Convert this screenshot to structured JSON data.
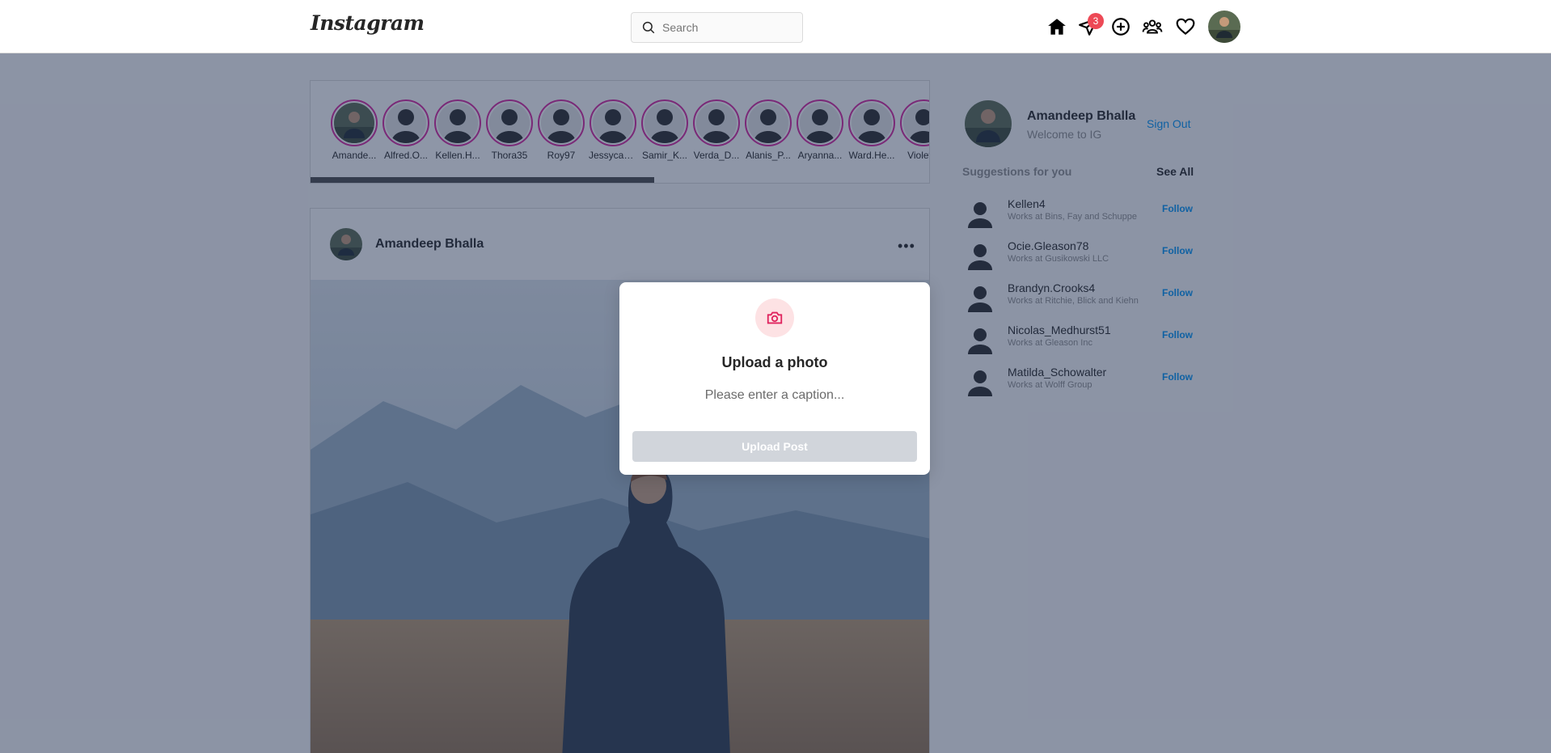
{
  "header": {
    "logo": "Instagram",
    "search_placeholder": "Search",
    "notification_count": "3"
  },
  "stories": [
    {
      "name": "Amande..."
    },
    {
      "name": "Alfred.O..."
    },
    {
      "name": "Kellen.H..."
    },
    {
      "name": "Thora35"
    },
    {
      "name": "Roy97"
    },
    {
      "name": "Jessyca_..."
    },
    {
      "name": "Samir_K..."
    },
    {
      "name": "Verda_D..."
    },
    {
      "name": "Alanis_P..."
    },
    {
      "name": "Aryanna..."
    },
    {
      "name": "Ward.He..."
    },
    {
      "name": "Violette"
    }
  ],
  "post": {
    "username": "Amandeep Bhalla",
    "more_label": "•••"
  },
  "sidebar": {
    "profile_name": "Amandeep Bhalla",
    "welcome": "Welcome to IG",
    "sign_out": "Sign Out",
    "suggestions_title": "Suggestions for you",
    "see_all": "See All",
    "follow_label": "Follow",
    "suggestions": [
      {
        "name": "Kellen4",
        "desc": "Works at Bins, Fay and Schuppe"
      },
      {
        "name": "Ocie.Gleason78",
        "desc": "Works at Gusikowski LLC"
      },
      {
        "name": "Brandyn.Crooks4",
        "desc": "Works at Ritchie, Blick and Kiehn"
      },
      {
        "name": "Nicolas_Medhurst51",
        "desc": "Works at Gleason Inc"
      },
      {
        "name": "Matilda_Schowalter",
        "desc": "Works at Wolff Group"
      }
    ]
  },
  "modal": {
    "title": "Upload a photo",
    "caption_placeholder": "Please enter a caption...",
    "upload_button": "Upload Post",
    "icon": "camera-icon"
  },
  "colors": {
    "accent": "#0095f6",
    "badge": "#ed4956",
    "story_ring": "#d6249f",
    "overlay": "#1e2d50"
  }
}
